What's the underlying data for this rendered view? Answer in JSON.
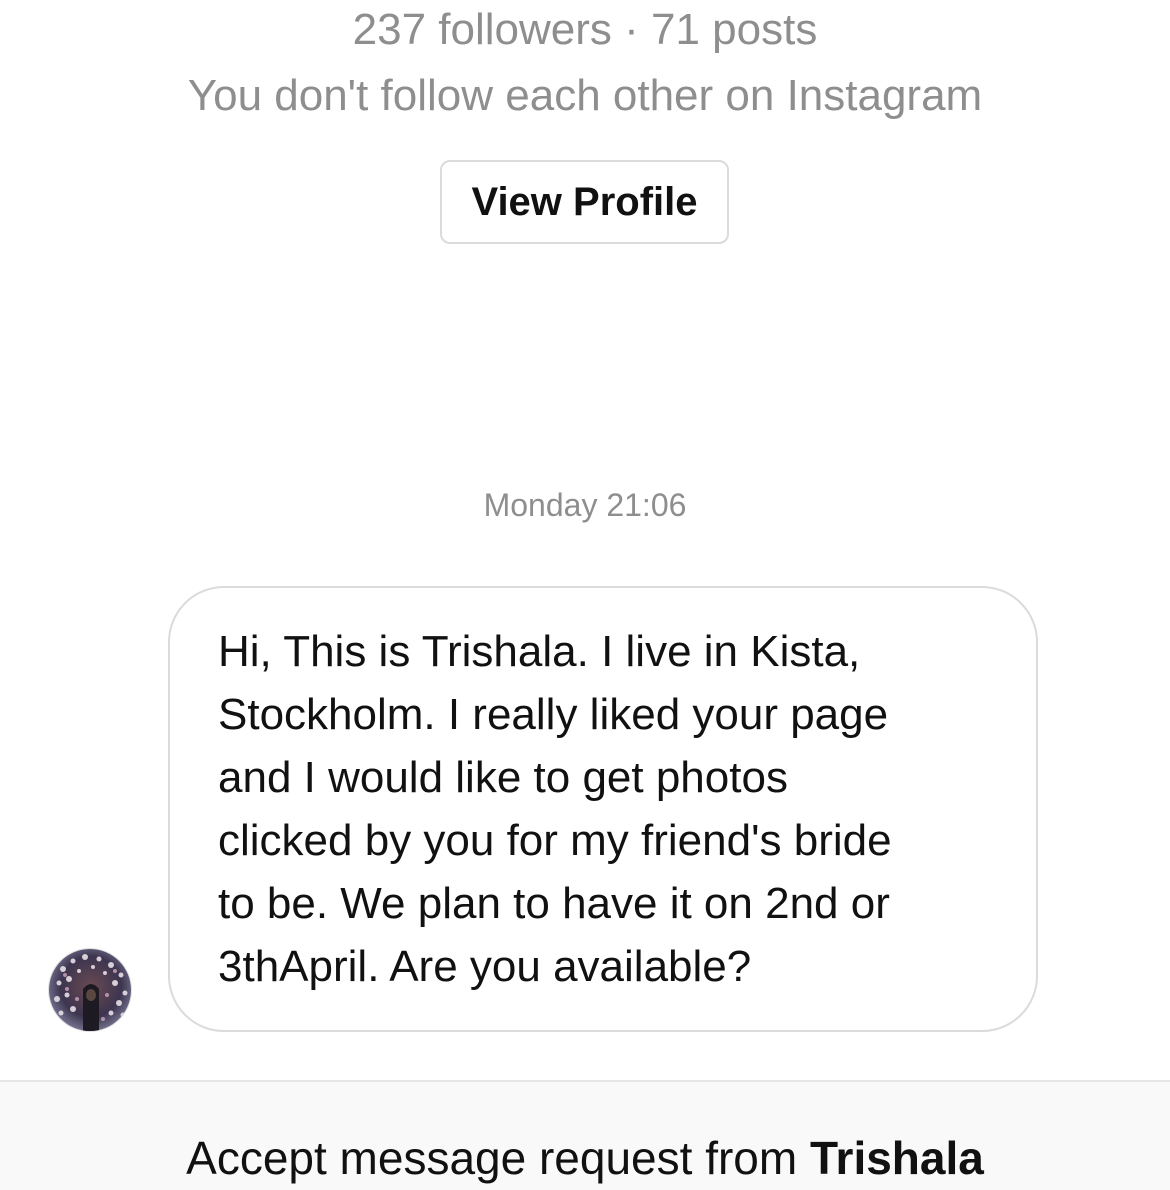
{
  "profile": {
    "stats": "237 followers · 71 posts",
    "follow_status": "You don't follow each other on Instagram",
    "view_profile_label": "View Profile"
  },
  "thread": {
    "timestamp": "Monday 21:06",
    "messages": [
      {
        "sender": "Trishala",
        "text": "Hi, This is Trishala. I live in Kista,\nStockholm. I really liked your page\nand I would like to get photos\nclicked by you for my friend's bride\nto be. We plan to have it on 2nd or\n3thApril. Are you available?"
      }
    ]
  },
  "request": {
    "prefix": "Accept message request from ",
    "name": "Trishala"
  },
  "icons": {
    "avatar": "user-avatar-photo"
  },
  "colors": {
    "secondary_text": "#8e8e8e",
    "border": "#dbdbdb",
    "primary_text": "#111111",
    "footer_bg": "#f9f9f9"
  }
}
